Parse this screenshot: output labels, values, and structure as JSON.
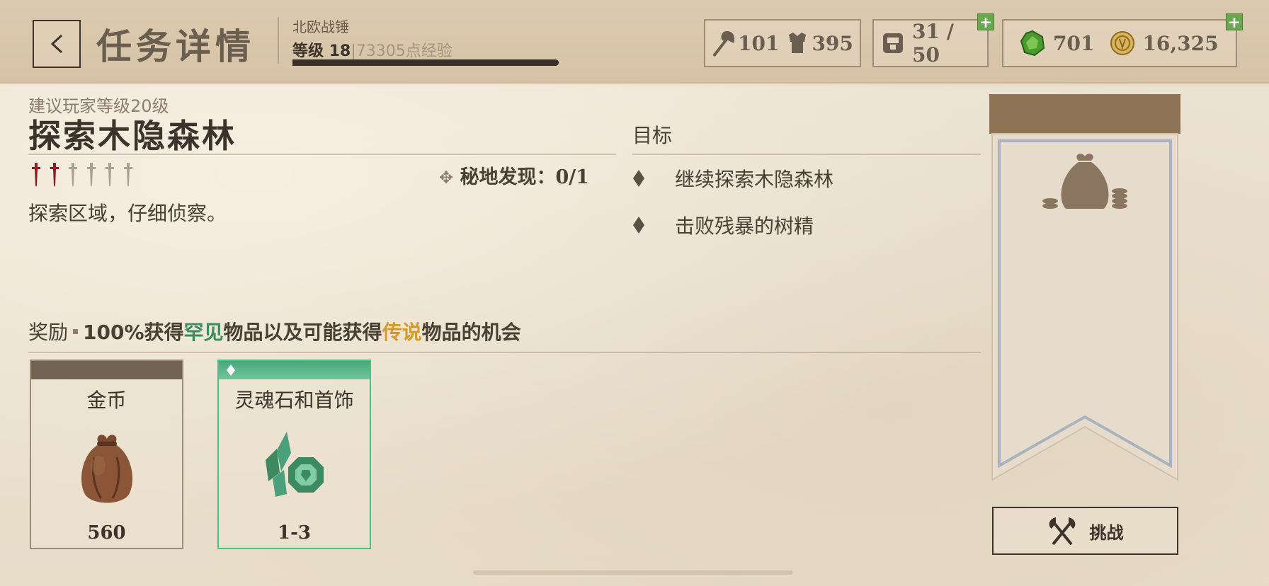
{
  "header": {
    "title": "任务详情",
    "character_name": "北欧战锤",
    "level_label": "等级",
    "level_value": "18",
    "xp_separator": "|",
    "xp_text": "73305点经验",
    "xp_progress": 1.0
  },
  "stats": {
    "attack": "101",
    "armor": "395",
    "inventory": "31 / 50",
    "gems": "701",
    "gold": "16,325",
    "plus_symbol": "+"
  },
  "quest": {
    "recommended_level": "建议玩家等级20级",
    "title": "探索木隐森林",
    "difficulty_filled": 2,
    "difficulty_total": 6,
    "discovery_label": "秘地发现：",
    "discovery_value": "0/1",
    "description": "探索区域，仔细侦察。"
  },
  "objectives": {
    "title": "目标",
    "items": [
      "继续探索木隐森林",
      "击败残暴的树精"
    ]
  },
  "rewards": {
    "label": "奖励",
    "text_prefix": "100%获得",
    "rare_word": "罕见",
    "text_mid": "物品以及可能获得",
    "legendary_word": "传说",
    "text_suffix": "物品的机会",
    "cards": [
      {
        "name": "金币",
        "qty": "560",
        "rarity": "common",
        "icon": "coin-pouch-icon"
      },
      {
        "name": "灵魂石和首饰",
        "qty": "1-3",
        "rarity": "rare",
        "icon": "soul-gem-icon"
      }
    ]
  },
  "challenge": {
    "label": "挑战"
  },
  "colors": {
    "rare": "#3d8a62",
    "legendary": "#d49a2c",
    "difficulty_active": "#8b1e1e"
  }
}
